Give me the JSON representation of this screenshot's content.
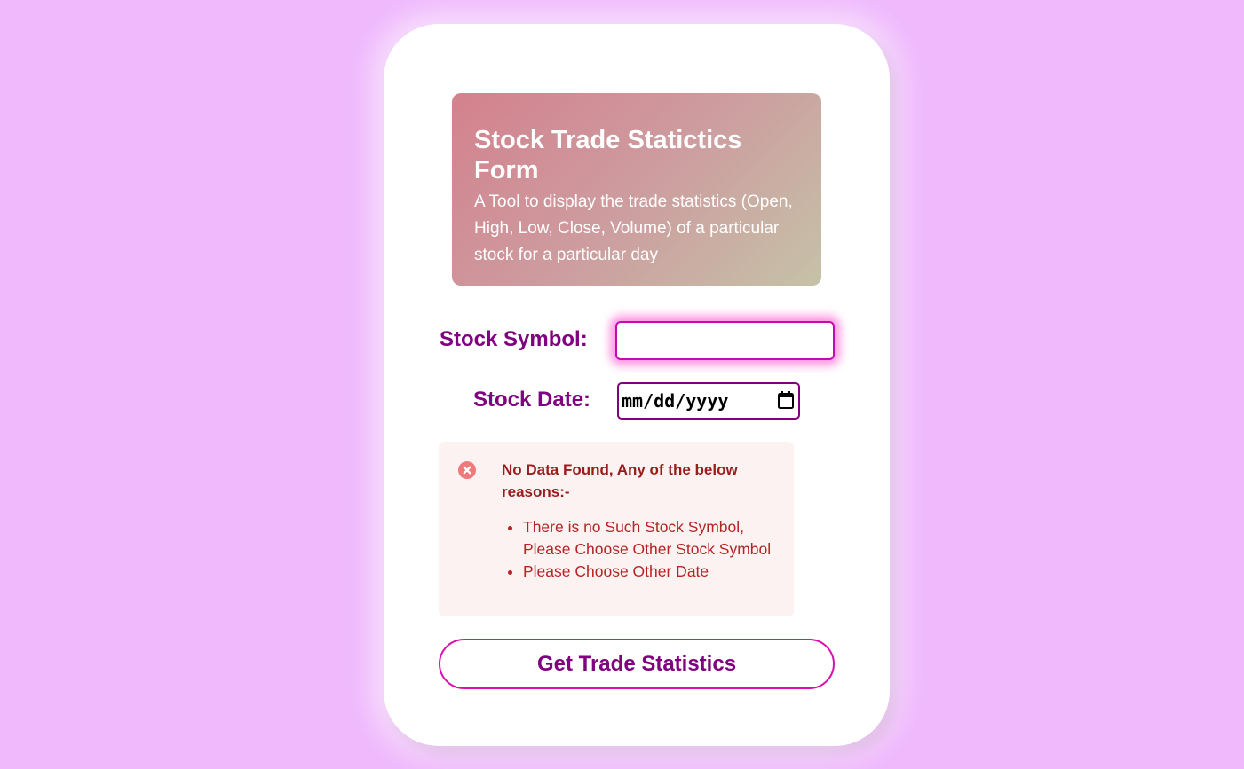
{
  "header": {
    "title": "Stock Trade Statictics Form",
    "description": "A Tool to display the trade statistics (Open, High, Low, Close, Volume) of a particular stock for a particular day"
  },
  "form": {
    "symbol_label": "Stock Symbol:",
    "symbol_value": "",
    "date_label": "Stock Date:",
    "date_placeholder": "mm/dd/yyyy"
  },
  "alert": {
    "icon": "x-circle-icon",
    "title": "No Data Found, Any of the below reasons:-",
    "reasons": [
      "There is no Such Stock Symbol, Please Choose Other Stock Symbol",
      "Please Choose Other Date"
    ]
  },
  "submit_label": "Get Trade Statistics",
  "colors": {
    "background": "#efb9fc",
    "accent": "#800080",
    "focus_border": "#c40bb0",
    "alert_bg": "#fdf2f2",
    "alert_text": "#9b1c1c"
  }
}
